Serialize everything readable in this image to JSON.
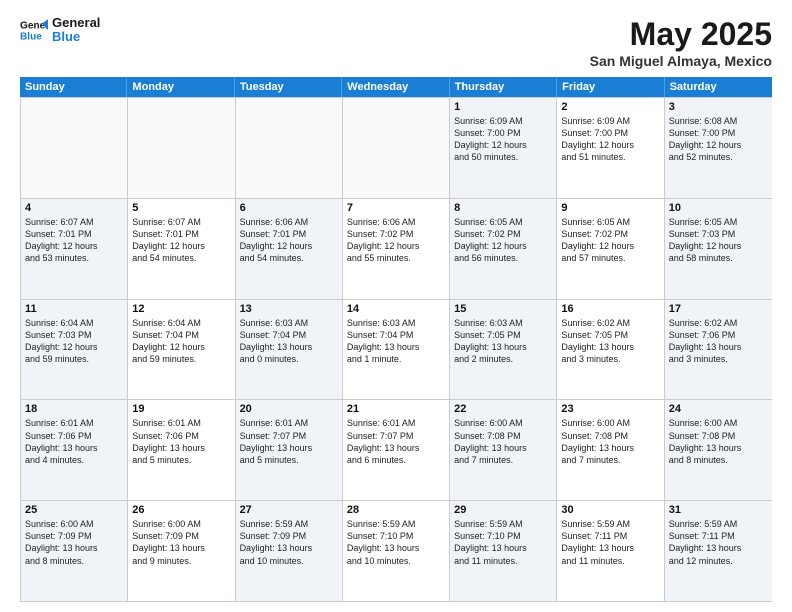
{
  "header": {
    "logo_general": "General",
    "logo_blue": "Blue",
    "month_title": "May 2025",
    "location": "San Miguel Almaya, Mexico"
  },
  "days_of_week": [
    "Sunday",
    "Monday",
    "Tuesday",
    "Wednesday",
    "Thursday",
    "Friday",
    "Saturday"
  ],
  "weeks": [
    {
      "cells": [
        {
          "day": "",
          "text": "",
          "empty": true
        },
        {
          "day": "",
          "text": "",
          "empty": true
        },
        {
          "day": "",
          "text": "",
          "empty": true
        },
        {
          "day": "",
          "text": "",
          "empty": true
        },
        {
          "day": "1",
          "text": "Sunrise: 6:09 AM\nSunset: 7:00 PM\nDaylight: 12 hours\nand 50 minutes."
        },
        {
          "day": "2",
          "text": "Sunrise: 6:09 AM\nSunset: 7:00 PM\nDaylight: 12 hours\nand 51 minutes."
        },
        {
          "day": "3",
          "text": "Sunrise: 6:08 AM\nSunset: 7:00 PM\nDaylight: 12 hours\nand 52 minutes."
        }
      ]
    },
    {
      "cells": [
        {
          "day": "4",
          "text": "Sunrise: 6:07 AM\nSunset: 7:01 PM\nDaylight: 12 hours\nand 53 minutes."
        },
        {
          "day": "5",
          "text": "Sunrise: 6:07 AM\nSunset: 7:01 PM\nDaylight: 12 hours\nand 54 minutes."
        },
        {
          "day": "6",
          "text": "Sunrise: 6:06 AM\nSunset: 7:01 PM\nDaylight: 12 hours\nand 54 minutes."
        },
        {
          "day": "7",
          "text": "Sunrise: 6:06 AM\nSunset: 7:02 PM\nDaylight: 12 hours\nand 55 minutes."
        },
        {
          "day": "8",
          "text": "Sunrise: 6:05 AM\nSunset: 7:02 PM\nDaylight: 12 hours\nand 56 minutes."
        },
        {
          "day": "9",
          "text": "Sunrise: 6:05 AM\nSunset: 7:02 PM\nDaylight: 12 hours\nand 57 minutes."
        },
        {
          "day": "10",
          "text": "Sunrise: 6:05 AM\nSunset: 7:03 PM\nDaylight: 12 hours\nand 58 minutes."
        }
      ]
    },
    {
      "cells": [
        {
          "day": "11",
          "text": "Sunrise: 6:04 AM\nSunset: 7:03 PM\nDaylight: 12 hours\nand 59 minutes."
        },
        {
          "day": "12",
          "text": "Sunrise: 6:04 AM\nSunset: 7:04 PM\nDaylight: 12 hours\nand 59 minutes."
        },
        {
          "day": "13",
          "text": "Sunrise: 6:03 AM\nSunset: 7:04 PM\nDaylight: 13 hours\nand 0 minutes."
        },
        {
          "day": "14",
          "text": "Sunrise: 6:03 AM\nSunset: 7:04 PM\nDaylight: 13 hours\nand 1 minute."
        },
        {
          "day": "15",
          "text": "Sunrise: 6:03 AM\nSunset: 7:05 PM\nDaylight: 13 hours\nand 2 minutes."
        },
        {
          "day": "16",
          "text": "Sunrise: 6:02 AM\nSunset: 7:05 PM\nDaylight: 13 hours\nand 3 minutes."
        },
        {
          "day": "17",
          "text": "Sunrise: 6:02 AM\nSunset: 7:06 PM\nDaylight: 13 hours\nand 3 minutes."
        }
      ]
    },
    {
      "cells": [
        {
          "day": "18",
          "text": "Sunrise: 6:01 AM\nSunset: 7:06 PM\nDaylight: 13 hours\nand 4 minutes."
        },
        {
          "day": "19",
          "text": "Sunrise: 6:01 AM\nSunset: 7:06 PM\nDaylight: 13 hours\nand 5 minutes."
        },
        {
          "day": "20",
          "text": "Sunrise: 6:01 AM\nSunset: 7:07 PM\nDaylight: 13 hours\nand 5 minutes."
        },
        {
          "day": "21",
          "text": "Sunrise: 6:01 AM\nSunset: 7:07 PM\nDaylight: 13 hours\nand 6 minutes."
        },
        {
          "day": "22",
          "text": "Sunrise: 6:00 AM\nSunset: 7:08 PM\nDaylight: 13 hours\nand 7 minutes."
        },
        {
          "day": "23",
          "text": "Sunrise: 6:00 AM\nSunset: 7:08 PM\nDaylight: 13 hours\nand 7 minutes."
        },
        {
          "day": "24",
          "text": "Sunrise: 6:00 AM\nSunset: 7:08 PM\nDaylight: 13 hours\nand 8 minutes."
        }
      ]
    },
    {
      "cells": [
        {
          "day": "25",
          "text": "Sunrise: 6:00 AM\nSunset: 7:09 PM\nDaylight: 13 hours\nand 8 minutes."
        },
        {
          "day": "26",
          "text": "Sunrise: 6:00 AM\nSunset: 7:09 PM\nDaylight: 13 hours\nand 9 minutes."
        },
        {
          "day": "27",
          "text": "Sunrise: 5:59 AM\nSunset: 7:09 PM\nDaylight: 13 hours\nand 10 minutes."
        },
        {
          "day": "28",
          "text": "Sunrise: 5:59 AM\nSunset: 7:10 PM\nDaylight: 13 hours\nand 10 minutes."
        },
        {
          "day": "29",
          "text": "Sunrise: 5:59 AM\nSunset: 7:10 PM\nDaylight: 13 hours\nand 11 minutes."
        },
        {
          "day": "30",
          "text": "Sunrise: 5:59 AM\nSunset: 7:11 PM\nDaylight: 13 hours\nand 11 minutes."
        },
        {
          "day": "31",
          "text": "Sunrise: 5:59 AM\nSunset: 7:11 PM\nDaylight: 13 hours\nand 12 minutes."
        }
      ]
    }
  ]
}
